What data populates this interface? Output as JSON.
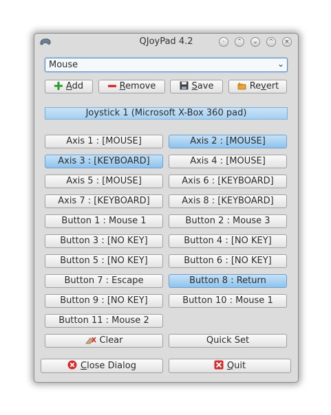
{
  "window": {
    "title": "QJoyPad 4.2"
  },
  "profile": {
    "selected": "Mouse"
  },
  "toolbar": {
    "add": {
      "label": "Add",
      "mnemonic": "A",
      "rest": "dd"
    },
    "remove": {
      "label": "Remove",
      "mnemonic": "R",
      "rest": "emove"
    },
    "save": {
      "label": "Save",
      "mnemonic": "S",
      "rest": "ave"
    },
    "revert": {
      "label": "Revert",
      "pre": "Re",
      "mnemonic": "v",
      "rest": "ert"
    }
  },
  "joystick": {
    "label": "Joystick 1 (Microsoft X-Box 360 pad)"
  },
  "buttons": [
    "Axis 1 : [MOUSE]",
    "Axis 2 : [MOUSE]",
    "Axis 3 : [KEYBOARD]",
    "Axis 4 : [MOUSE]",
    "Axis 5 : [MOUSE]",
    "Axis 6 : [KEYBOARD]",
    "Axis 7 : [KEYBOARD]",
    "Axis 8 : [KEYBOARD]",
    "Button 1 : Mouse 1",
    "Button 2 : Mouse 3",
    "Button 3 : [NO KEY]",
    "Button 4 : [NO KEY]",
    "Button 5 : [NO KEY]",
    "Button 6 : [NO KEY]",
    "Button 7 : Escape",
    "Button 8 : Return",
    "Button 9 : [NO KEY]",
    "Button 10 : Mouse 1",
    "Button 11 : Mouse 2"
  ],
  "selected_buttons": [
    "Axis 2 : [MOUSE]",
    "Axis 3 : [KEYBOARD]",
    "Button 8 : Return"
  ],
  "actions": {
    "clear": "Clear",
    "quick_set": "Quick Set"
  },
  "footer": {
    "close": {
      "label": "Close Dialog",
      "mnemonic": "C",
      "rest": "lose Dialog"
    },
    "quit": {
      "label": "Quit",
      "mnemonic": "Q",
      "rest": "uit"
    }
  },
  "icons": {
    "add": "plus-icon",
    "remove": "minus-icon",
    "save": "floppy-icon",
    "revert": "revert-icon",
    "clear": "eraser-icon",
    "close": "close-circle-icon",
    "quit": "quit-icon"
  },
  "colors": {
    "selected": "#a9d2f2",
    "add_green": "#2e9a2e",
    "remove_red": "#d42b2b"
  }
}
